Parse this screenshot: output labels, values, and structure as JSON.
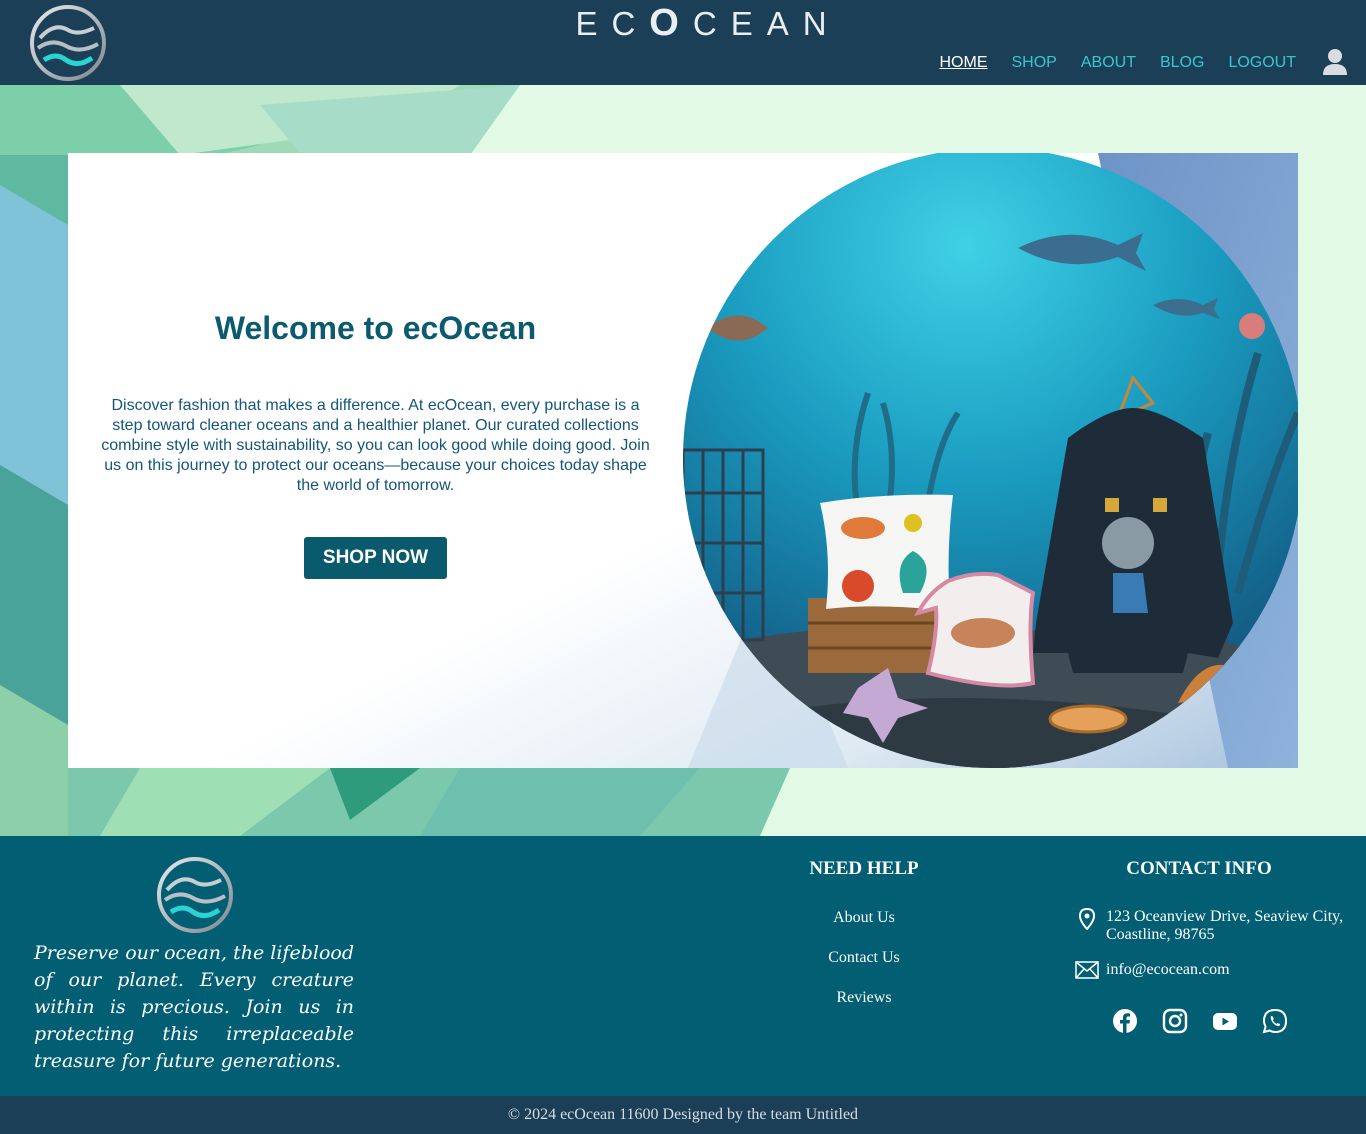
{
  "header": {
    "brand_prefix": "EC",
    "brand_big": "O",
    "brand_suffix": "CEAN",
    "nav": [
      {
        "label": "HOME",
        "active": true
      },
      {
        "label": "SHOP",
        "active": false
      },
      {
        "label": "ABOUT",
        "active": false
      },
      {
        "label": "BLOG",
        "active": false
      },
      {
        "label": "LOGOUT",
        "active": false
      }
    ],
    "user_icon": "user-icon"
  },
  "hero": {
    "title": "Welcome to ecOcean",
    "description": "Discover fashion that makes a difference. At ecOcean, every purchase is a step toward cleaner oceans and a healthier planet. Our curated collections combine style with sustainability, so you can look good while doing good. Join us on this journey to protect our oceans—because your choices today shape the world of tomorrow.",
    "cta_label": "SHOP NOW"
  },
  "footer": {
    "tagline": "Preserve our ocean, the lifeblood of our planet. Every creature within is precious. Join us in protecting this irreplaceable treasure for future generations.",
    "help_title": "NEED HELP",
    "help_links": [
      "About Us",
      "Contact Us",
      "Reviews"
    ],
    "contact_title": "CONTACT INFO",
    "address": "123 Oceanview Drive, Seaview City, Coastline, 98765",
    "email": "info@ecocean.com",
    "socials": [
      "facebook-icon",
      "instagram-icon",
      "youtube-icon",
      "whatsapp-icon"
    ],
    "copyright": "© 2024 ecOcean 11600 Designed by the team Untitled"
  },
  "colors": {
    "header_bg": "#1b3f57",
    "footer_bg": "#015e73",
    "accent": "#38c6d0",
    "button_bg": "#0a5a6e"
  }
}
